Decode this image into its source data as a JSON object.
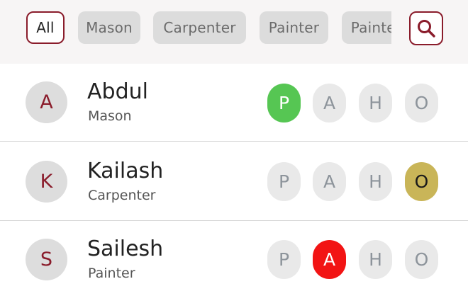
{
  "filters": {
    "chips": [
      {
        "label": "All",
        "active": true
      },
      {
        "label": "Mason",
        "active": false
      },
      {
        "label": "Carpenter",
        "active": false
      },
      {
        "label": "Painter",
        "active": false
      },
      {
        "label": "Painter",
        "active": false
      }
    ],
    "search_icon": "search-icon"
  },
  "workers": [
    {
      "initial": "A",
      "name": "Abdul",
      "role": "Mason",
      "statuses": [
        {
          "code": "P",
          "selected": true,
          "color": "#56c653"
        },
        {
          "code": "A",
          "selected": false
        },
        {
          "code": "H",
          "selected": false
        },
        {
          "code": "O",
          "selected": false
        }
      ]
    },
    {
      "initial": "K",
      "name": "Kailash",
      "role": "Carpenter",
      "statuses": [
        {
          "code": "P",
          "selected": false
        },
        {
          "code": "A",
          "selected": false
        },
        {
          "code": "H",
          "selected": false
        },
        {
          "code": "O",
          "selected": true,
          "color": "#c9b558"
        }
      ]
    },
    {
      "initial": "S",
      "name": "Sailesh",
      "role": "Painter",
      "statuses": [
        {
          "code": "P",
          "selected": false
        },
        {
          "code": "A",
          "selected": true,
          "color": "#f21414"
        },
        {
          "code": "H",
          "selected": false
        },
        {
          "code": "O",
          "selected": false
        }
      ]
    }
  ],
  "colors": {
    "accent": "#8a1c2b",
    "chip_bg": "#dcdcdc",
    "status_bg": "#e9e9e9",
    "status_text": "#8d949b"
  }
}
